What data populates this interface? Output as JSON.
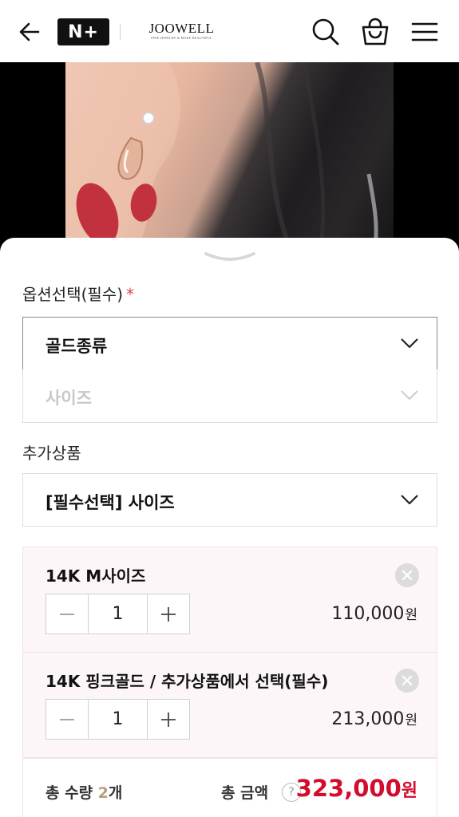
{
  "header": {
    "back_icon": "back-arrow-icon",
    "badge": "N+",
    "brand_name": "JOOWELL",
    "brand_tagline": "FINE JEWELRY & MAKE BEAUTIFUL",
    "icons": [
      "search-icon",
      "shopping-bag-icon",
      "menu-icon"
    ]
  },
  "options": {
    "label": "옵션선택(필수)",
    "required_mark": "*",
    "gold_type": "골드종류",
    "size": "사이즈"
  },
  "addon": {
    "label": "추가상품",
    "select": "[필수선택] 사이즈"
  },
  "items": [
    {
      "name": "14K M사이즈",
      "minus": "−",
      "qty": "1",
      "plus": "+",
      "price": "110,000",
      "currency": "원"
    },
    {
      "name": "14K 핑크골드 / 추가상품에서 선택(필수)",
      "minus": "−",
      "qty": "1",
      "plus": "+",
      "price": "213,000",
      "currency": "원"
    }
  ],
  "total": {
    "qty_prefix": "총 수량 ",
    "qty_value": "2",
    "qty_suffix": "개",
    "amount_label": "총 금액",
    "help": "?",
    "amount": "323,000",
    "currency": "원"
  },
  "colors": {
    "accent": "#d30c2b",
    "required": "#e0474c",
    "item_bg": "#fdf6f9"
  }
}
